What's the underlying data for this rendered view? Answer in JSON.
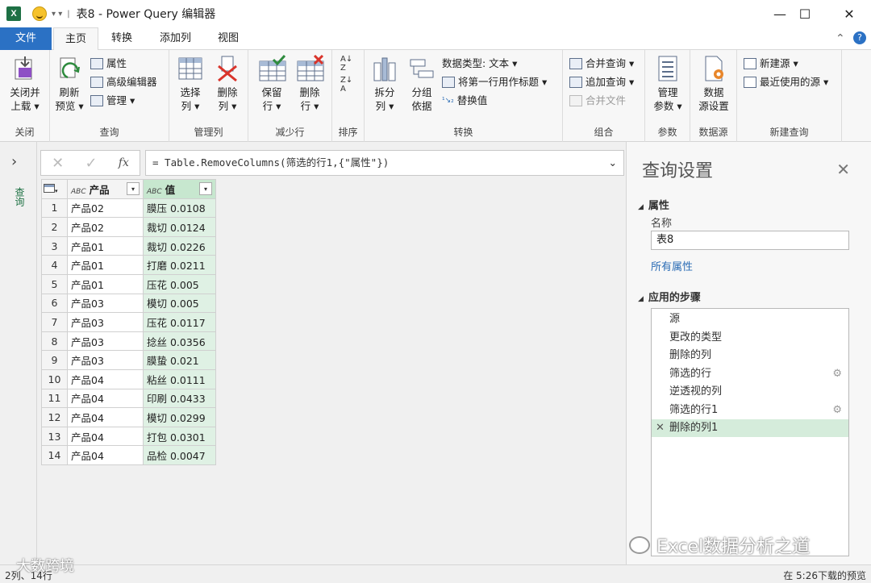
{
  "window": {
    "title": "表8 - Power Query 编辑器",
    "minimize": "—",
    "maximize": "☐",
    "close": "✕",
    "app_icon": "X"
  },
  "menu": {
    "tabs": [
      "文件",
      "主页",
      "转换",
      "添加列",
      "视图"
    ],
    "help": "?",
    "collapse": "⌃"
  },
  "ribbon": {
    "groups": {
      "close": "关闭",
      "query": "查询",
      "manage_cols": "管理列",
      "reduce_rows": "减少行",
      "sort": "排序",
      "transform": "转换",
      "combine": "组合",
      "params": "参数",
      "datasource": "数据源",
      "newquery": "新建查询"
    },
    "close_load": [
      "关闭并",
      "上载 ▾"
    ],
    "refresh": [
      "刷新",
      "预览 ▾"
    ],
    "properties": "属性",
    "advanced_editor": "高级编辑器",
    "manage": "管理 ▾",
    "choose_cols": [
      "选择",
      "列 ▾"
    ],
    "remove_cols": [
      "删除",
      "列 ▾"
    ],
    "keep_rows": [
      "保留",
      "行 ▾"
    ],
    "remove_rows": [
      "删除",
      "行 ▾"
    ],
    "split": [
      "拆分",
      "列 ▾"
    ],
    "group_by": [
      "分组",
      "依据"
    ],
    "data_type": "数据类型: 文本 ▾",
    "first_row": "将第一行用作标题 ▾",
    "replace": "替换值",
    "merge": "合并查询 ▾",
    "append": "追加查询 ▾",
    "combine_files": "合并文件",
    "manage_params": [
      "管理",
      "参数 ▾"
    ],
    "ds_settings": [
      "数据",
      "源设置"
    ],
    "new_source": "新建源 ▾",
    "recent": "最近使用的源 ▾"
  },
  "formula": {
    "text": "= Table.RemoveColumns(筛选的行1,{\"属性\"})",
    "fx": "fx",
    "cancel": "✕",
    "confirm": "✓"
  },
  "leftbar": {
    "label": "查询"
  },
  "table": {
    "headers": [
      "产品",
      "值"
    ],
    "rows": [
      [
        "1",
        "产品02",
        "膜压 0.0108"
      ],
      [
        "2",
        "产品02",
        "裁切 0.0124"
      ],
      [
        "3",
        "产品01",
        "裁切 0.0226"
      ],
      [
        "4",
        "产品01",
        "打磨 0.0211"
      ],
      [
        "5",
        "产品01",
        "压花 0.005"
      ],
      [
        "6",
        "产品03",
        "模切 0.005"
      ],
      [
        "7",
        "产品03",
        "压花 0.0117"
      ],
      [
        "8",
        "产品03",
        "捻丝 0.0356"
      ],
      [
        "9",
        "产品03",
        "膜蛰 0.021"
      ],
      [
        "10",
        "产品04",
        "粘丝 0.0111"
      ],
      [
        "11",
        "产品04",
        "印刷 0.0433"
      ],
      [
        "12",
        "产品04",
        "模切 0.0299"
      ],
      [
        "13",
        "产品04",
        "打包 0.0301"
      ],
      [
        "14",
        "产品04",
        "品检 0.0047"
      ]
    ]
  },
  "panel": {
    "title": "查询设置",
    "props_header": "属性",
    "name_label": "名称",
    "name_value": "表8",
    "all_props": "所有属性",
    "steps_header": "应用的步骤",
    "steps": [
      "源",
      "更改的类型",
      "删除的列",
      "筛选的行",
      "逆透视的列",
      "筛选的行1",
      "删除的列1"
    ]
  },
  "status": {
    "left": "2列、14行",
    "right": "在 5:26下载的预览"
  },
  "watermark": {
    "right": "Excel数据分析之道",
    "left": "大数跨境"
  }
}
